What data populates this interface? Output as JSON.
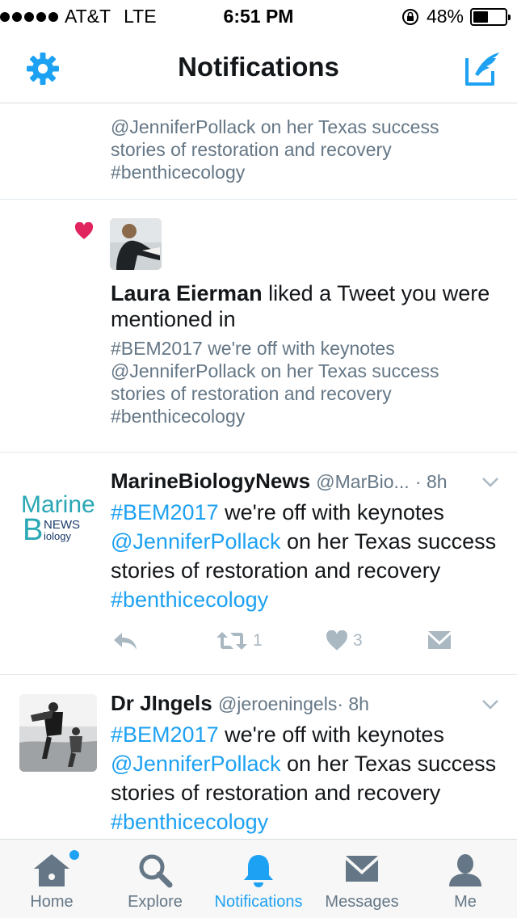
{
  "status_bar": {
    "carrier": "AT&T",
    "network": "LTE",
    "time": "6:51 PM",
    "battery_text": "48%",
    "battery_level": 0.48
  },
  "nav": {
    "title": "Notifications",
    "left_icon": "gear-icon",
    "right_icon": "compose-icon"
  },
  "notifications": {
    "cut_item": {
      "lines": [
        "@JenniferPollack on her Texas success",
        "stories of restoration and recovery",
        "#benthicecology"
      ]
    },
    "like_item": {
      "name": "Laura Eierman",
      "action": " liked a Tweet you were mentioned in",
      "quote_lines": [
        "#BEM2017 we're off with keynotes",
        "@JenniferPollack on her Texas success",
        "stories of restoration and recovery",
        "#benthicecology"
      ]
    },
    "tweets": [
      {
        "name": "MarineBiologyNews",
        "handle": "@MarBio...",
        "time": "· 8h",
        "avatar_text": [
          "Marine",
          "B",
          "NEWS",
          "iology"
        ],
        "text_parts": {
          "hashtag1": "#BEM2017",
          "t1": " we're off with keynotes ",
          "mention": "@JenniferPollack",
          "t2": " on her Texas success stories of restoration and recovery ",
          "hashtag2": "#benthicecology"
        },
        "retweets": "1",
        "likes": "3"
      },
      {
        "name": "Dr JIngels",
        "handle": "@jeroeningels",
        "time": "· 8h",
        "text_parts": {
          "hashtag1": "#BEM2017",
          "t1": " we're off with keynotes ",
          "mention": "@JenniferPollack",
          "t2": " on her Texas success stories of restoration and recovery ",
          "hashtag2": "#benthicecology"
        }
      }
    ]
  },
  "tabs": [
    {
      "label": "Home",
      "icon": "home-icon"
    },
    {
      "label": "Explore",
      "icon": "search-icon"
    },
    {
      "label": "Notifications",
      "icon": "bell-icon",
      "active": true
    },
    {
      "label": "Messages",
      "icon": "envelope-icon"
    },
    {
      "label": "Me",
      "icon": "person-icon"
    }
  ],
  "colors": {
    "accent": "#1da1f2",
    "like_red": "#e0245e",
    "text": "#14171a",
    "secondary": "#657786"
  }
}
